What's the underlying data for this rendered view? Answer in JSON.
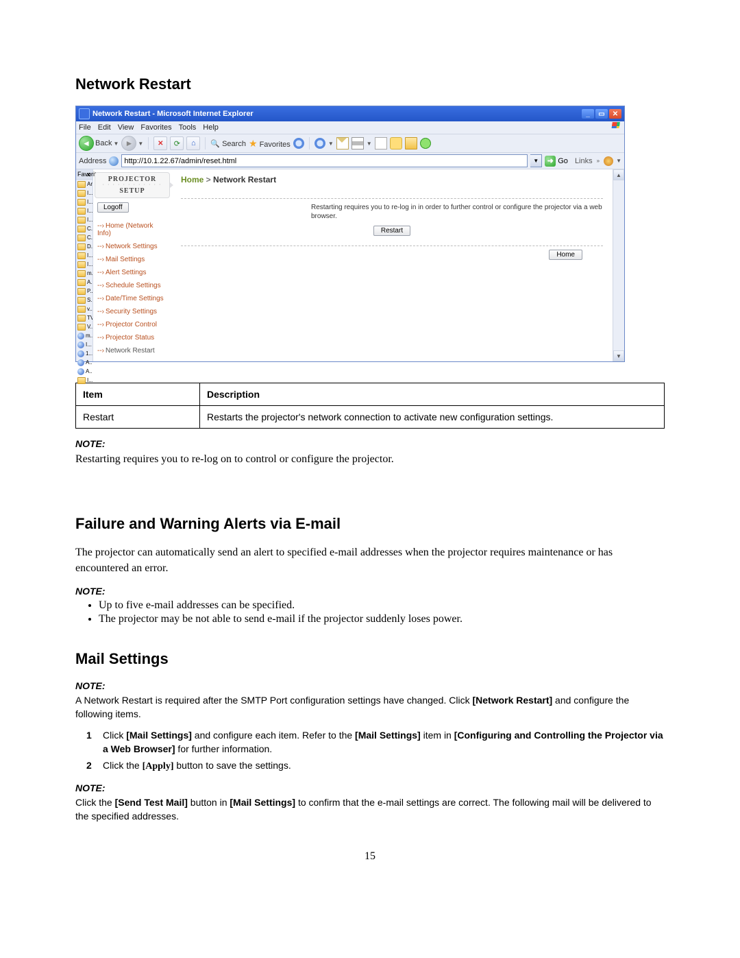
{
  "headings": {
    "h1": "Network Restart",
    "h2": "Failure and Warning Alerts via E-mail",
    "h3": "Mail Settings"
  },
  "browser": {
    "title": "Network Restart - Microsoft Internet Explorer",
    "menu": [
      "File",
      "Edit",
      "View",
      "Favorites",
      "Tools",
      "Help"
    ],
    "back_label": "Back",
    "search_label": "Search",
    "favorites_label": "Favorites",
    "address_label": "Address",
    "address_value": "http://10.1.22.67/admin/reset.html",
    "go_label": "Go",
    "links_label": "Links"
  },
  "favpane": {
    "title": "Favorit",
    "items": [
      "Ar...",
      "I...",
      "I...",
      "I...",
      "I...",
      "C...",
      "C...",
      "D...",
      "I...",
      "I...",
      "m...",
      "A...",
      "P...",
      "S...",
      "v...",
      "TV",
      "V...",
      "m...",
      "I...",
      "1...",
      "A...",
      "A...",
      "I..."
    ]
  },
  "projector": {
    "logo_top": "PROJECTOR",
    "logo_bottom": "SETUP",
    "logoff": "Logoff",
    "nav": [
      {
        "label": "Home (Network Info)",
        "cls": "red"
      },
      {
        "label": "Network Settings",
        "cls": "red"
      },
      {
        "label": "Mail Settings",
        "cls": "red"
      },
      {
        "label": "Alert Settings",
        "cls": "red"
      },
      {
        "label": "Schedule Settings",
        "cls": "red"
      },
      {
        "label": "Date/Time Settings",
        "cls": "red"
      },
      {
        "label": "Security Settings",
        "cls": "red"
      },
      {
        "label": "Projector Control",
        "cls": "red"
      },
      {
        "label": "Projector Status",
        "cls": "red"
      },
      {
        "label": "Network Restart",
        "cls": "grey"
      }
    ],
    "crumb_home": "Home",
    "crumb_sep": " > ",
    "crumb_current": "Network Restart",
    "restart_msg": "Restarting requires you to re-log in in order to further control or configure the projector via a web browser.",
    "restart_btn": "Restart",
    "home_btn": "Home"
  },
  "table": {
    "h_item": "Item",
    "h_desc": "Description",
    "row_item": "Restart",
    "row_desc": "Restarts the projector's network connection to activate new configuration settings."
  },
  "notes": {
    "label": "NOTE:",
    "note1": "Restarting requires you to re-log on to control or configure the projector.",
    "para_failure": "The projector can automatically send an alert to specified e-mail addresses when the projector requires maintenance or has encountered an error.",
    "bullet1": "Up to five e-mail addresses can be specified.",
    "bullet2": "The projector may be not able to send e-mail if the projector suddenly loses power.",
    "mail_note": "A Network Restart is required after the SMTP Port configuration settings have changed. Click ",
    "mail_note_b": "[Network Restart]",
    "mail_note2": " and configure the following items.",
    "step1_a": "Click ",
    "step1_b": "[Mail Settings]",
    "step1_c": " and configure each item. Refer to the ",
    "step1_d": "[Mail Settings]",
    "step1_e": " item in ",
    "step1_f": "[Configuring and Controlling the Projector via a Web Browser]",
    "step1_g": " for further information.",
    "step2_a": "Click the ",
    "step2_b": "[Apply]",
    "step2_c": " button to save the settings.",
    "note_click_a": "Click the ",
    "note_click_b": "[Send Test Mail]",
    "note_click_c": " button in ",
    "note_click_d": "[Mail Settings]",
    "note_click_e": " to confirm that the e-mail settings are correct. The following mail will be delivered to the specified addresses."
  },
  "page_number": "15"
}
